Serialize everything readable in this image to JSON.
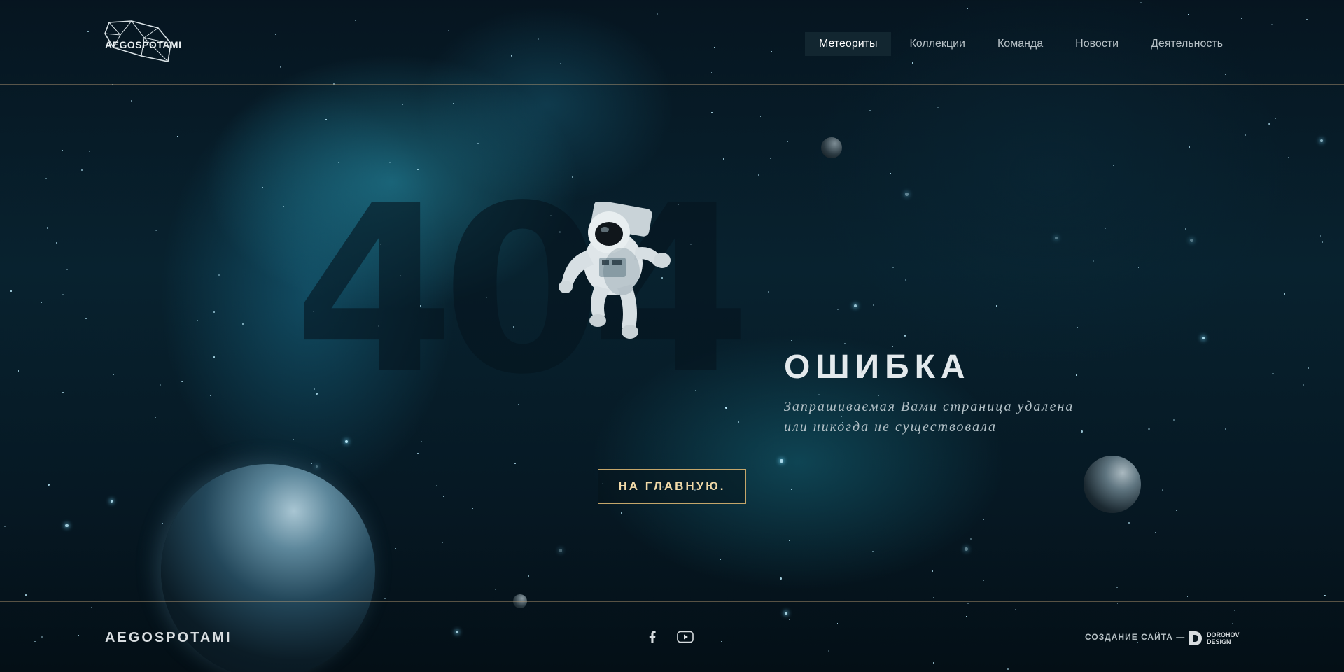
{
  "header": {
    "logo_text": "AEGOSPOTAMI",
    "nav": [
      {
        "label": "Метеориты",
        "active": true
      },
      {
        "label": "Коллекции",
        "active": false
      },
      {
        "label": "Команда",
        "active": false
      },
      {
        "label": "Новости",
        "active": false
      },
      {
        "label": "Деятельность",
        "active": false
      }
    ]
  },
  "hero": {
    "code": "404",
    "title": "ОШИБКА",
    "description_line1": "Запрашиваемая Вами страница удалена",
    "description_line2": "или никогда не существовала",
    "button_label": "НА ГЛАВНУЮ."
  },
  "footer": {
    "brand": "AEGOSPOTAMI",
    "social": [
      {
        "icon": "facebook-icon"
      },
      {
        "icon": "youtube-icon"
      }
    ],
    "credit_label": "СОЗДАНИЕ САЙТА —",
    "studio_line1": "DOROHOV",
    "studio_line2": "DESIGN"
  },
  "colors": {
    "background": "#061823",
    "accent_gold": "#c4a66a",
    "button_text": "#f0d9a8",
    "divider": "#be a078"
  }
}
